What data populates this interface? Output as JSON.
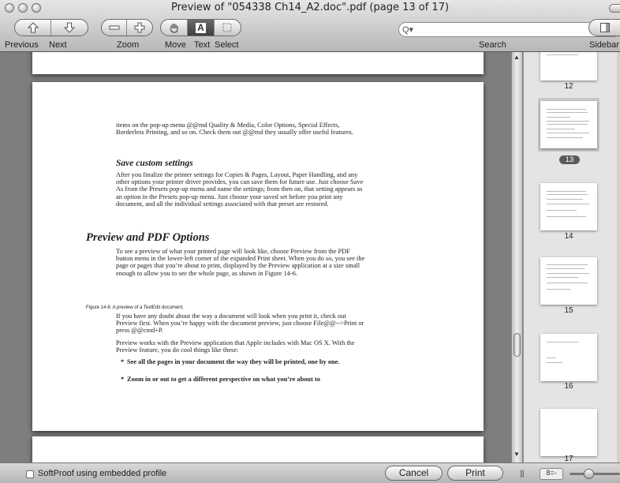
{
  "window": {
    "title": "Preview of \"054338 Ch14_A2.doc\".pdf (page 13 of 17)"
  },
  "toolbar": {
    "previous_label": "Previous",
    "next_label": "Next",
    "zoom_label": "Zoom",
    "move_label": "Move",
    "text_label": "Text",
    "select_label": "Select",
    "search_label": "Search",
    "sidebar_label": "Sidebar",
    "search_placeholder": "",
    "active_tool": "text",
    "icons": {
      "previous": "arrow-up-icon",
      "next": "arrow-down-icon",
      "zoom_out": "minus-icon",
      "zoom_in": "plus-icon",
      "move": "hand-icon",
      "text": "text-cursor-icon",
      "select": "marquee-icon",
      "search": "magnifier-icon",
      "sidebar": "sidebar-icon"
    }
  },
  "document": {
    "para1": "items on the pop-up menu @@md Quality & Media, Color Options, Special Effects, Borderless Printing, and so on. Check them out @@md they usually offer useful features.",
    "heading_save": "Save custom settings",
    "para2": "After you finalize the printer settings for Copies & Pages, Layout, Paper Handling, and any other options your printer driver provides, you can save them for future use. Just choose Save As from the Presets pop-up menu and name the settings; from then on, that setting appears as an option in the Presets pop-up menu. Just choose your saved set before you print any document, and all the individual settings associated with that preset are restored.",
    "heading_preview": "Preview and PDF Options",
    "para3": "To see a preview of what your printed page will look like, choose Preview from the PDF button menu in the lower-left corner of the expanded Print sheet. When you do so, you see the page or pages that you’re about to print, displayed by the Preview application at a size small enough to allow you to see the whole page, as shown in Figure 14-6.",
    "figure_caption": "Figure 14-6: A preview of a TextEdit document.",
    "para4": "If you have any doubt about the way a document will look when you print it, check out Preview first. When you’re happy with the document preview, just choose File@@-->Print or press @@cmd+P.",
    "para5": "Preview works with the Preview application that Apple includes with Mac OS X. With the Preview feature, you do cool things like these:",
    "bullet1": "See all the pages in your document the way they will be printed, one by one.",
    "bullet2": "Zoom in or out to get a different perspective on what you’re about to",
    "bullet_char": "*"
  },
  "sidebar": {
    "thumbnails": [
      {
        "label": "12",
        "selected": false
      },
      {
        "label": "13",
        "selected": true
      },
      {
        "label": "14",
        "selected": false
      },
      {
        "label": "15",
        "selected": false
      },
      {
        "label": "16",
        "selected": false
      },
      {
        "label": "17",
        "selected": false
      }
    ]
  },
  "bottom_bar": {
    "softproof_label": "SoftProof using embedded profile",
    "softproof_checked": false,
    "cancel_label": "Cancel",
    "print_label": "Print",
    "view_menu_label": "8=-",
    "grip_glyph": "|||"
  }
}
